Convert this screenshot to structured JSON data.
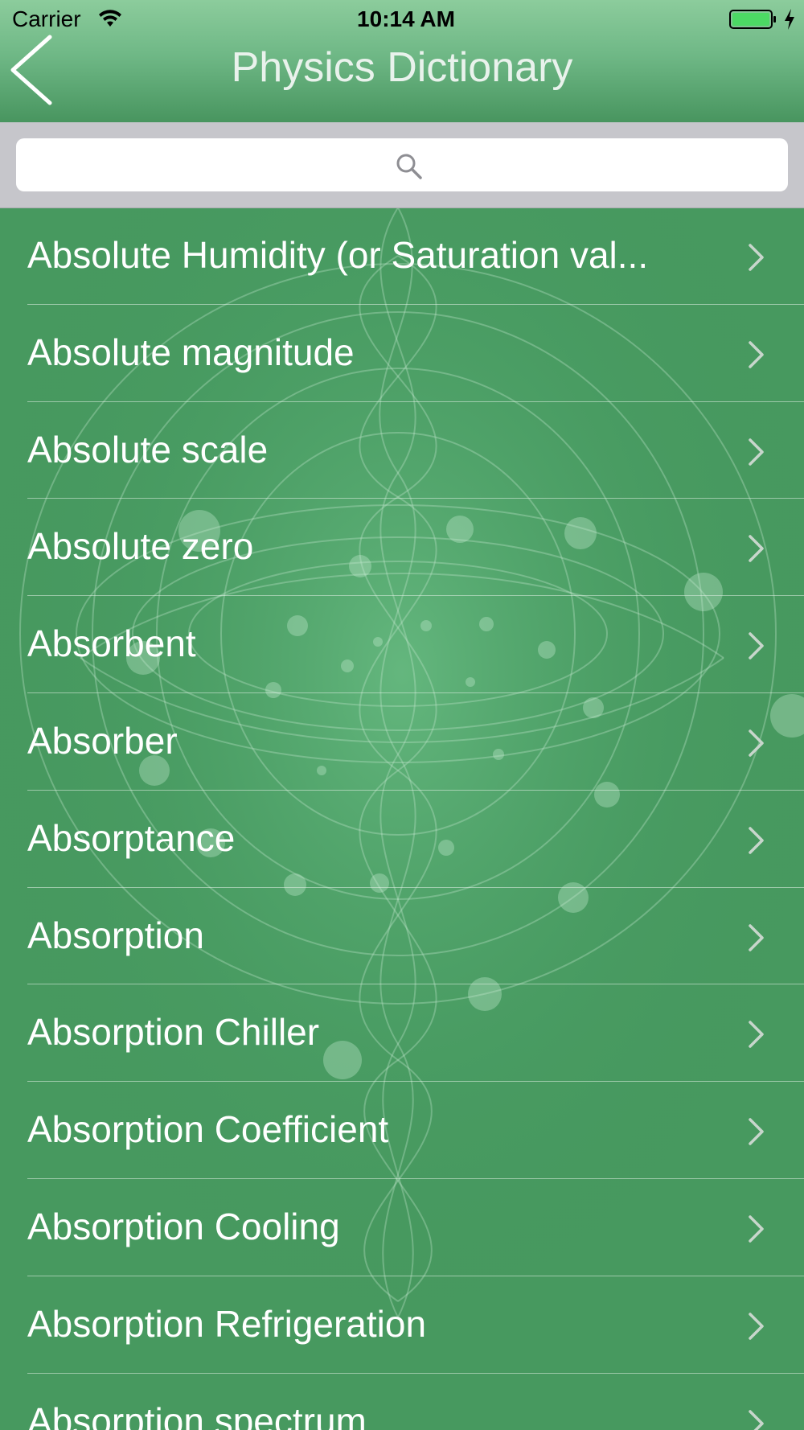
{
  "status_bar": {
    "carrier": "Carrier",
    "time": "10:14 AM"
  },
  "nav": {
    "title": "Physics Dictionary",
    "back_icon": "chevron-left-icon"
  },
  "search": {
    "placeholder": "",
    "value": "",
    "icon": "search-icon"
  },
  "terms": [
    "Absolute Humidity (or Saturation val...",
    "Absolute magnitude",
    "Absolute scale",
    "Absolute zero",
    "Absorbent",
    "Absorber",
    "Absorptance",
    "Absorption",
    "Absorption Chiller",
    "Absorption Coefficient",
    "Absorption Cooling",
    "Absorption Refrigeration",
    "Absorption spectrum"
  ],
  "colors": {
    "nav_gradient_top": "#8ccc9c",
    "nav_gradient_bottom": "#48955f",
    "list_background": "#4a9e68",
    "search_bar_background": "#c6c6cb",
    "title_text": "#e9f2ec",
    "battery_fill": "#4cd964"
  }
}
